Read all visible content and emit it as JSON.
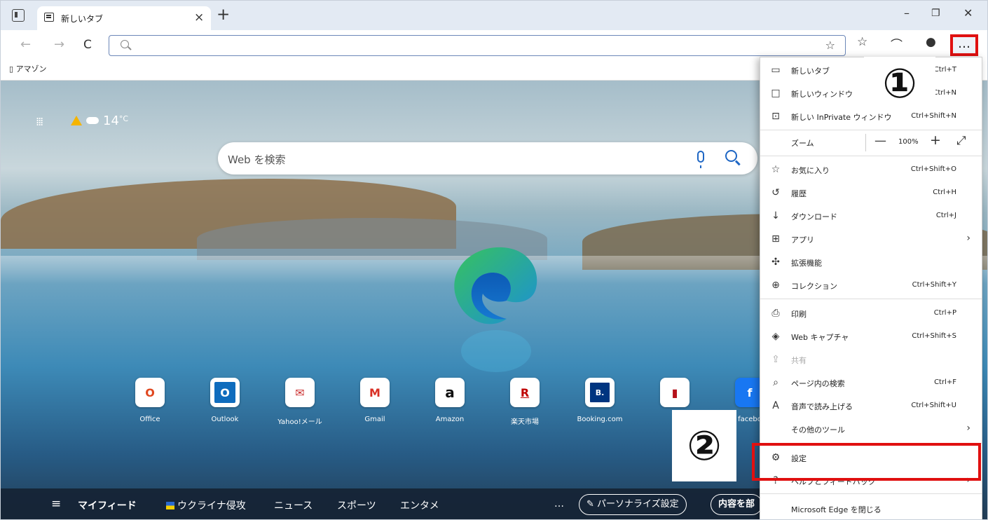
{
  "tab": {
    "title": "新しいタブ",
    "close": "×",
    "new_tab": "+"
  },
  "window": {
    "minimize": "–",
    "restore": "❐",
    "close": "✕"
  },
  "toolbar": {
    "back": "←",
    "forward": "→",
    "refresh": "C",
    "address_value": "",
    "more": "…"
  },
  "favorites": {
    "items": [
      "アマゾン"
    ]
  },
  "newtab": {
    "weather_temp": "14",
    "weather_unit": "°C",
    "search_placeholder": "Web を検索",
    "tiles": [
      "Office",
      "Outlook",
      "Yahoo!メール",
      "Gmail",
      "Amazon",
      "楽天市場",
      "Booking.com",
      "",
      "facebo"
    ],
    "tile_glyphs": [
      "O",
      "O",
      "✉",
      "M",
      "a",
      "R",
      "B.",
      "▮",
      "f"
    ],
    "feed": {
      "my_feed": "マイフィード",
      "ukraine": "ウクライナ侵攻",
      "news": "ニュース",
      "sports": "スポーツ",
      "entertainment": "エンタメ",
      "more": "…",
      "personalize": "パーソナライズ設定",
      "content": "内容を部"
    }
  },
  "menu": {
    "new_tab": {
      "label": "新しいタブ",
      "shortcut": "Ctrl+T"
    },
    "new_window": {
      "label": "新しいウィンドウ",
      "shortcut": "Ctrl+N"
    },
    "new_inprivate": {
      "label": "新しい InPrivate ウィンドウ",
      "shortcut": "Ctrl+Shift+N"
    },
    "zoom": {
      "label": "ズーム",
      "minus": "—",
      "value": "100%",
      "plus": "+"
    },
    "favorites": {
      "label": "お気に入り",
      "shortcut": "Ctrl+Shift+O"
    },
    "history": {
      "label": "履歴",
      "shortcut": "Ctrl+H"
    },
    "downloads": {
      "label": "ダウンロード",
      "shortcut": "Ctrl+J"
    },
    "apps": {
      "label": "アプリ"
    },
    "extensions": {
      "label": "拡張機能"
    },
    "collections": {
      "label": "コレクション",
      "shortcut": "Ctrl+Shift+Y"
    },
    "print": {
      "label": "印刷",
      "shortcut": "Ctrl+P"
    },
    "web_capture": {
      "label": "Web キャプチャ",
      "shortcut": "Ctrl+Shift+S"
    },
    "share": {
      "label": "共有"
    },
    "find": {
      "label": "ページ内の検索",
      "shortcut": "Ctrl+F"
    },
    "read_aloud": {
      "label": "音声で読み上げる",
      "shortcut": "Ctrl+Shift+U"
    },
    "more_tools": {
      "label": "その他のツール"
    },
    "settings": {
      "label": "設定"
    },
    "help": {
      "label": "ヘルプとフィードバック"
    },
    "close_edge": {
      "label": "Microsoft Edge を閉じる"
    }
  },
  "annotations": {
    "step1": "①",
    "step2": "②"
  },
  "colors": {
    "highlight": "#e01010",
    "accent": "#1e66c4"
  }
}
